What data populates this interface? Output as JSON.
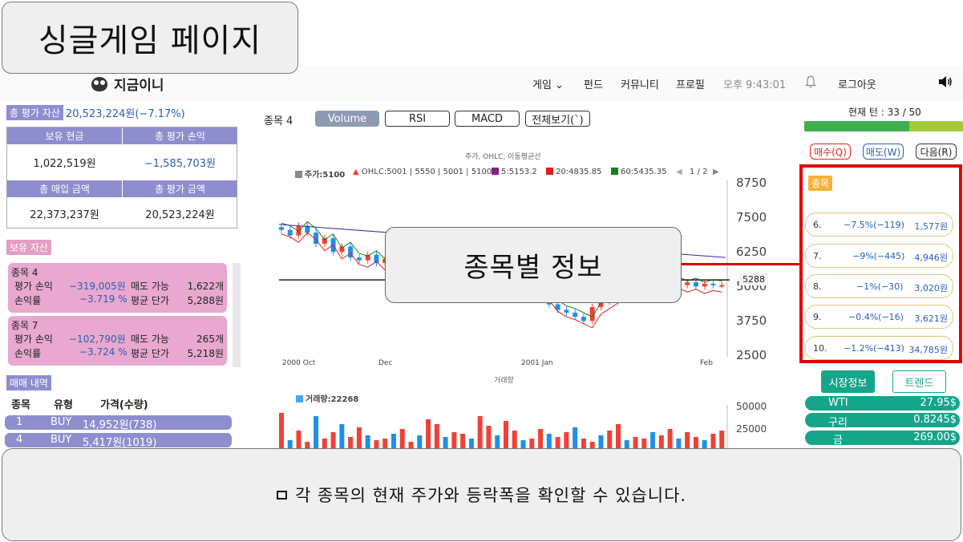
{
  "slide": {
    "title": "싱글게임 페이지",
    "overlay_label": "종목별 정보",
    "caption": "각 종목의 현재 주가와 등락폭을 확인할 수 있습니다."
  },
  "nav": {
    "logo": "지금이니",
    "game": "게임 ⌄",
    "fund": "펀드",
    "community": "커뮤니티",
    "profile": "프로필",
    "time": "오후 9:43:01",
    "logout": "로그아웃"
  },
  "assets": {
    "total_label": "총 평가 자산",
    "total_value": "20,523,224원(−7.17%)",
    "cash_label": "보유 현금",
    "cash_value": "1,022,519원",
    "pnl_label": "총 평가 손익",
    "pnl_value": "−1,585,703원",
    "buy_label": "총 매입 금액",
    "buy_value": "22,373,237원",
    "eval_label": "총 평가 금액",
    "eval_value": "20,523,224원"
  },
  "holdings": {
    "label": "보유 자산",
    "items": [
      {
        "name": "종목 4",
        "pnl_label": "평가 손익",
        "pnl": "−319,005원",
        "sell_label": "매도 가능",
        "sell": "1,622개",
        "rate_label": "손익률",
        "rate": "−3.719 %",
        "avg_label": "평균 단가",
        "avg": "5,288원"
      },
      {
        "name": "종목 7",
        "pnl_label": "평가 손익",
        "pnl": "−102,790원",
        "sell_label": "매도 가능",
        "sell": "265개",
        "rate_label": "손익률",
        "rate": "−3.724 %",
        "avg_label": "평균 단가",
        "avg": "5,218원"
      }
    ]
  },
  "trades": {
    "label": "매매 내역",
    "col_stock": "종목",
    "col_type": "유형",
    "col_price": "가격(수량)",
    "rows": [
      {
        "stock": "1",
        "type": "BUY",
        "price": "14,952원(738)"
      },
      {
        "stock": "4",
        "type": "BUY",
        "price": "5,417원(1019)"
      }
    ]
  },
  "chart_panel": {
    "stock": "종목 4",
    "tabs": [
      "Volume",
      "RSI",
      "MACD",
      "전체보기(`)"
    ],
    "active_tab": "Volume",
    "title": "주가, OHLC, 이동평균선",
    "legend": {
      "price": "주가:5100",
      "ohlc": "OHLC:5001 | 5550 | 5001 | 5100",
      "ma5": "5:5153.2",
      "ma20": "20:4835.85",
      "ma60": "60:5435.35",
      "page": "1 / 2"
    },
    "price_badge": "5288",
    "volume_title": "거래량",
    "volume_legend": "거래량:22268",
    "colors": {
      "up": "#ef4136",
      "down": "#1e90e8",
      "ma5": "#8b1a8b",
      "ma20": "#e02020",
      "ma60": "#1e7a1e",
      "ma_long": "#3030a0"
    }
  },
  "chart_data": [
    {
      "type": "candlestick",
      "title": "주가, OHLC, 이동평균선",
      "x_ticks": [
        "2000 Oct",
        "Dec",
        "2001 Jan",
        "Feb"
      ],
      "y_ticks": [
        2500,
        3750,
        5000,
        6250,
        7500,
        8750
      ],
      "ylim": [
        2500,
        8750
      ],
      "series": [
        {
          "name": "주가",
          "last": 5100
        },
        {
          "name": "5",
          "last": 5153.2
        },
        {
          "name": "20",
          "last": 4835.85
        },
        {
          "name": "60",
          "last": 5435.35
        }
      ],
      "reference_line": 5288
    },
    {
      "type": "bar",
      "title": "거래량",
      "y_ticks": [
        25000,
        50000
      ],
      "series": [
        {
          "name": "거래량",
          "last": 22268
        }
      ]
    }
  ],
  "right": {
    "turn": "현재 턴 : 33 / 50",
    "turn_progress": 0.66,
    "buy": "매수(Q)",
    "sell": "매도(W)",
    "next": "다음(R)",
    "stock_panel": "종목",
    "stocks": [
      {
        "no": "6.",
        "change": "−7.5%(−119)",
        "price": "1,577원"
      },
      {
        "no": "7.",
        "change": "−9%(−445)",
        "price": "4,946원"
      },
      {
        "no": "8.",
        "change": "−1%(−30)",
        "price": "3,020원"
      },
      {
        "no": "9.",
        "change": "−0.4%(−16)",
        "price": "3,621원"
      },
      {
        "no": "10.",
        "change": "−1.2%(−413)",
        "price": "34,785원"
      }
    ],
    "market_tab": "시장정보",
    "trend_tab": "트렌드",
    "market": [
      {
        "name": "WTI",
        "value": "27.95$"
      },
      {
        "name": "구리",
        "value": "0.8245$"
      },
      {
        "name": "금",
        "value": "269.00$"
      }
    ]
  }
}
